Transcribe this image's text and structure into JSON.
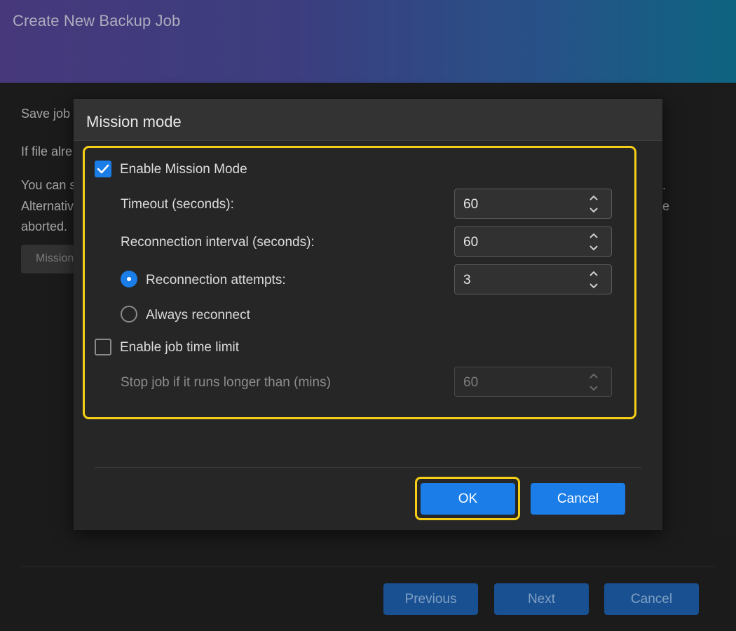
{
  "window": {
    "title": "Create New Backup Job"
  },
  "background": {
    "line1": "Save job",
    "line2": "If file alre",
    "line3": "You can s",
    "line4": "Alternativ",
    "line5": "aborted.",
    "right_line3": ".",
    "right_line4": "e",
    "mission_button": "Mission",
    "footer": {
      "previous": "Previous",
      "next": "Next",
      "cancel": "Cancel"
    }
  },
  "dialog": {
    "title": "Mission mode",
    "enable_mission_mode": {
      "label": "Enable Mission Mode",
      "checked": true
    },
    "timeout": {
      "label": "Timeout (seconds):",
      "value": "60"
    },
    "reconnection_interval": {
      "label": "Reconnection interval (seconds):",
      "value": "60"
    },
    "reconnection_attempts": {
      "label": "Reconnection attempts:",
      "value": "3",
      "selected": true
    },
    "always_reconnect": {
      "label": "Always reconnect",
      "selected": false
    },
    "enable_job_time_limit": {
      "label": "Enable job time limit",
      "checked": false
    },
    "stop_job": {
      "label": "Stop job if it runs longer than (mins)",
      "value": "60",
      "disabled": true
    },
    "ok_label": "OK",
    "cancel_label": "Cancel"
  },
  "colors": {
    "accent": "#1a7de8",
    "focus_highlight": "#f5cf17",
    "dialog_bg": "#262626",
    "page_bg": "#1f1f1f"
  },
  "icons": {
    "checkbox_check": "checkmark-icon",
    "spin_up": "chevron-up-icon",
    "spin_down": "chevron-down-icon"
  }
}
